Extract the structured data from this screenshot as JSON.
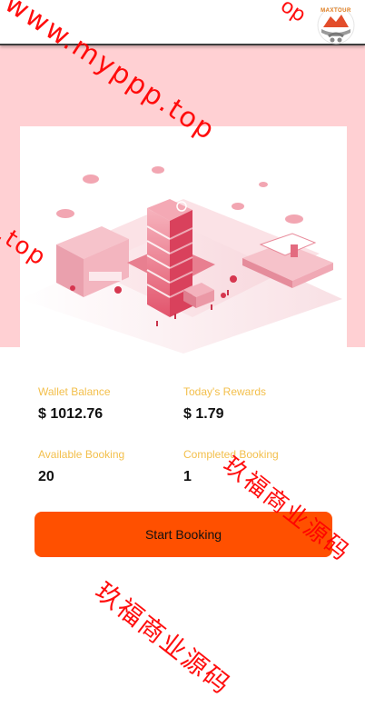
{
  "header": {
    "logo_text": "MAXTOUR",
    "logo_icon": "maxtour-logo-icon"
  },
  "hero": {
    "illustration": "isometric-city-illustration",
    "accent_color": "#ffd0d3"
  },
  "stats": {
    "wallet_balance_label": "Wallet Balance",
    "wallet_balance_value": "$ 1012.76",
    "todays_rewards_label": "Today's Rewards",
    "todays_rewards_value": "$ 1.79",
    "available_booking_label": "Available Booking",
    "available_booking_value": "20",
    "completed_booking_label": "Completed Booking",
    "completed_booking_value": "1",
    "label_color": "#f3bf4b"
  },
  "actions": {
    "start_booking_label": "Start Booking",
    "button_color": "#ff5000"
  },
  "watermarks": {
    "url_text": "www.myppp.top",
    "fragment_text": "p.top",
    "top_fragment": "op",
    "cn_text": "玖福商业源码"
  }
}
